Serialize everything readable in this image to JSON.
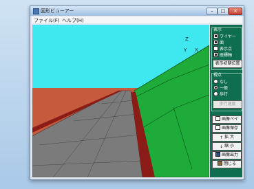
{
  "window": {
    "title": "図形ビューアー"
  },
  "titlebar_buttons": {
    "minimize": "–",
    "maximize": "□",
    "close": "×"
  },
  "menu": {
    "file": "ファイル(F)",
    "help": "ヘルプ(H)"
  },
  "axes": {
    "z": "Z",
    "y": "Y",
    "x": "X"
  },
  "panel": {
    "display": {
      "title": "表示",
      "items": [
        {
          "label": "ワイヤー",
          "checked": true
        },
        {
          "label": "面",
          "checked": true
        },
        {
          "label": "表示点",
          "checked": false
        },
        {
          "label": "座標軸",
          "checked": true
        }
      ],
      "reset_button": "表示初期位置"
    },
    "mode": {
      "title": "視点",
      "options": [
        {
          "label": "なし",
          "selected": false
        },
        {
          "label": "一般",
          "selected": true
        },
        {
          "label": "歩行",
          "selected": false
        }
      ],
      "disabled_button": "歩行速度"
    },
    "buttons": [
      {
        "label": "画像ペイ",
        "icon": "document-icon"
      },
      {
        "label": "画像保存",
        "icon": "document-icon"
      },
      {
        "label": "拡 大",
        "icon": "zoom-in-icon"
      },
      {
        "label": "縮 小",
        "icon": "zoom-out-icon"
      },
      {
        "label": "画像出力",
        "icon": "save-icon"
      },
      {
        "label": "閉じる",
        "icon": "door-icon"
      }
    ]
  },
  "colors": {
    "sky": "#3fe7ee",
    "ground": "#c55a3d",
    "road": "#7b7b7b",
    "slope": "#1fab3a",
    "curb": "#8a1b16"
  }
}
